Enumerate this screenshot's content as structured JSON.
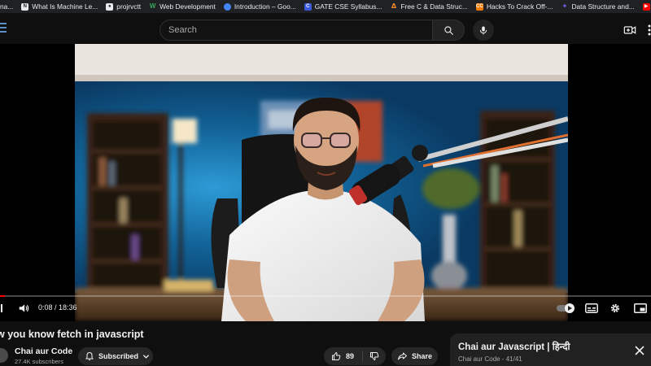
{
  "bookmarks": [
    {
      "label": "na...",
      "icon": "bookmark-icon",
      "color": "#4a6a8a"
    },
    {
      "label": "What Is Machine Le...",
      "icon": "notion-icon",
      "color": "#e8eaed"
    },
    {
      "label": "projrvctt",
      "icon": "github-icon",
      "color": "#e8eaed"
    },
    {
      "label": "Web Development",
      "icon": "w-icon",
      "color": "#3aa757"
    },
    {
      "label": "Introduction – Goo...",
      "icon": "globe-icon",
      "color": "#4285f4"
    },
    {
      "label": "GATE CSE Syllabus...",
      "icon": "c-icon",
      "color": "#3b5bdb"
    },
    {
      "label": "Free C & Data Struc...",
      "icon": "flame-icon",
      "color": "#f28b30"
    },
    {
      "label": "Hacks To Crack Off-...",
      "icon": "cc-icon",
      "color": "#f57c00"
    },
    {
      "label": "Data Structure and...",
      "icon": "star-icon",
      "color": "#7b61ff"
    },
    {
      "label": "YouTube",
      "icon": "youtube-icon",
      "color": "#ff0000"
    }
  ],
  "search": {
    "placeholder": "Search"
  },
  "player": {
    "time": "0:08 / 18:36",
    "progress": 0.007
  },
  "video": {
    "title": "w you know fetch in javascript",
    "channel": "Chai aur Code",
    "subscribers": "27.4K subscribers",
    "subscribed_label": "Subscribed",
    "likes": "89",
    "share_label": "Share"
  },
  "playlist": {
    "title": "Chai aur Javascript | हिन्दी",
    "meta": "Chai aur Code - 41/41"
  },
  "colors": {
    "accent": "#ff0000",
    "wall": "#0e4a78",
    "button_bg": "#272727"
  }
}
